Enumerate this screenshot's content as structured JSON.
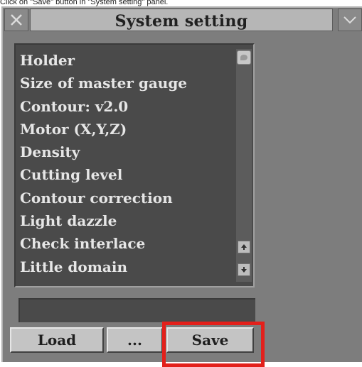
{
  "instruction": "Click on \"Save\" button in \"System setting\" panel.",
  "window": {
    "title": "System setting",
    "close_icon": "close-x-icon",
    "menu_icon": "chevron-down-icon"
  },
  "list": {
    "items": [
      {
        "label": "Holder"
      },
      {
        "label": "Size of master gauge"
      },
      {
        "label": "Contour: v2.0"
      },
      {
        "label": "Motor (X,Y,Z)"
      },
      {
        "label": "Density"
      },
      {
        "label": "Cutting level"
      },
      {
        "label": "Contour correction"
      },
      {
        "label": "Light dazzle"
      },
      {
        "label": "Check interlace"
      },
      {
        "label": "Little domain"
      }
    ],
    "scroll_up_icon": "arrow-up-icon",
    "scroll_down_icon": "arrow-down-icon"
  },
  "input": {
    "value": ""
  },
  "buttons": {
    "load_label": "Load",
    "more_label": "...",
    "save_label": "Save"
  },
  "colors": {
    "highlight": "#e3201b"
  }
}
